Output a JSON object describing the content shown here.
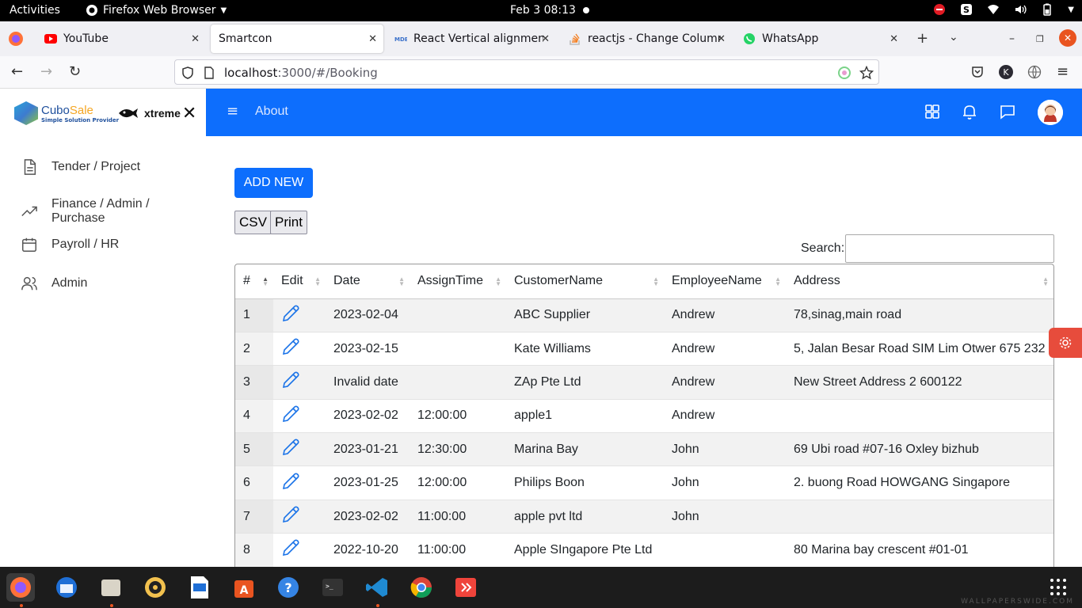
{
  "system": {
    "activities": "Activities",
    "app_name": "Firefox Web Browser",
    "clock": "Feb 3  08:13"
  },
  "browser": {
    "tabs": [
      {
        "title": "YouTube",
        "icon": "youtube-icon"
      },
      {
        "title": "Smartcon",
        "icon": "none"
      },
      {
        "title": "React Vertical alignment",
        "icon": "mdb-icon"
      },
      {
        "title": "reactjs - Change Column",
        "icon": "stackoverflow-icon"
      },
      {
        "title": "WhatsApp",
        "icon": "whatsapp-icon"
      }
    ],
    "url_host": "localhost",
    "url_path": ":3000/#/Booking",
    "profile_letter": "K"
  },
  "sidebar": {
    "logo_name": "Cubo",
    "logo_name2": "Sale",
    "logo_tagline": "Simple Solution Provider",
    "partner_logo": "xtreme",
    "items": [
      {
        "label": "Tender / Project",
        "icon": "document-icon"
      },
      {
        "label": "Finance / Admin / Purchase",
        "icon": "trending-up-icon"
      },
      {
        "label": "Payroll / HR",
        "icon": "calendar-icon"
      },
      {
        "label": "Admin",
        "icon": "users-icon"
      }
    ]
  },
  "header": {
    "about": "About"
  },
  "main": {
    "add_new": "ADD NEW",
    "csv": "CSV",
    "print": "Print",
    "search_label": "Search:",
    "search_value": ""
  },
  "table": {
    "columns": [
      "#",
      "Edit",
      "Date",
      "AssignTime",
      "CustomerName",
      "EmployeeName",
      "Address"
    ],
    "rows": [
      {
        "id": "1",
        "date": "2023-02-04",
        "time": "",
        "customer": "ABC Supplier",
        "employee": "Andrew",
        "address": "78,sinag,main road"
      },
      {
        "id": "2",
        "date": "2023-02-15",
        "time": "",
        "customer": "Kate Williams",
        "employee": "Andrew",
        "address": "5, Jalan Besar Road SIM Lim Otwer 675 232"
      },
      {
        "id": "3",
        "date": "Invalid date",
        "time": "",
        "customer": "ZAp Pte Ltd",
        "employee": "Andrew",
        "address": "New Street Address 2 600122"
      },
      {
        "id": "4",
        "date": "2023-02-02",
        "time": "12:00:00",
        "customer": "apple1",
        "employee": "Andrew",
        "address": ""
      },
      {
        "id": "5",
        "date": "2023-01-21",
        "time": "12:30:00",
        "customer": "Marina Bay",
        "employee": "John",
        "address": "69 Ubi road #07-16 Oxley bizhub"
      },
      {
        "id": "6",
        "date": "2023-01-25",
        "time": "12:00:00",
        "customer": "Philips Boon",
        "employee": "John",
        "address": "2. buong Road HOWGANG Singapore"
      },
      {
        "id": "7",
        "date": "2023-02-02",
        "time": "11:00:00",
        "customer": "apple pvt ltd",
        "employee": "John",
        "address": ""
      },
      {
        "id": "8",
        "date": "2022-10-20",
        "time": "11:00:00",
        "customer": "Apple SIngapore Pte Ltd",
        "employee": "",
        "address": "80 Marina bay crescent #01-01"
      }
    ]
  },
  "taskbar": {
    "watermark": "WALLPAPERSWIDE.COM"
  },
  "colors": {
    "primary": "#0d6efd",
    "settings_fab": "#e74c3c"
  }
}
